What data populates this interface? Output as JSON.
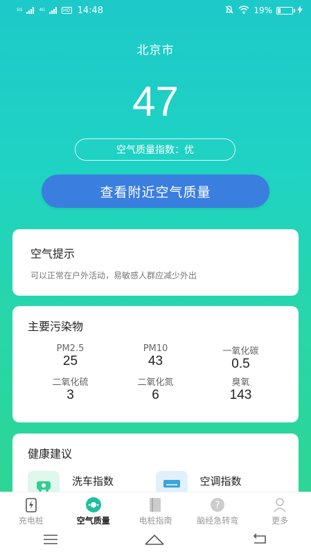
{
  "status_bar": {
    "network_1": "5G",
    "network_2": "4G",
    "hd": "HD",
    "time": "14:48",
    "battery_text": "19%",
    "battery_level": 0.19,
    "icons": [
      "mute-icon",
      "wifi-icon",
      "battery-icon",
      "charging-icon"
    ]
  },
  "city": "北京市",
  "aqi": {
    "value": "47",
    "label": "空气质量指数：优"
  },
  "nearby_button": "查看附近空气质量",
  "tips": {
    "title": "空气提示",
    "text": "可以正常在户外活动，易敏感人群应减少外出"
  },
  "pollutants": {
    "title": "主要污染物",
    "items": [
      {
        "name": "PM2.5",
        "value": "25"
      },
      {
        "name": "PM10",
        "value": "43"
      },
      {
        "name": "一氧化碳",
        "value": "0.5"
      },
      {
        "name": "二氧化硫",
        "value": "3"
      },
      {
        "name": "二氧化氮",
        "value": "6"
      },
      {
        "name": "臭氧",
        "value": "143"
      }
    ]
  },
  "health": {
    "title": "健康建议",
    "items": [
      {
        "label": "洗车指数",
        "icon": "car-wash-icon",
        "color": "#2fcf8f"
      },
      {
        "label": "空调指数",
        "icon": "air-conditioner-icon",
        "color": "#3aa3e0"
      }
    ]
  },
  "bottom_nav": {
    "items": [
      {
        "label": "充电桩",
        "icon": "charging-pile-icon"
      },
      {
        "label": "空气质量",
        "icon": "air-quality-icon"
      },
      {
        "label": "电桩指南",
        "icon": "book-icon"
      },
      {
        "label": "脑经急转弯",
        "icon": "question-icon"
      },
      {
        "label": "更多",
        "icon": "person-icon"
      }
    ],
    "active_index": 1
  },
  "colors": {
    "accent_button": "#3a7ee0",
    "active_nav": "#1fbf9f",
    "gradient_top": "#1ec9c9",
    "gradient_bottom": "#2fd58f"
  }
}
